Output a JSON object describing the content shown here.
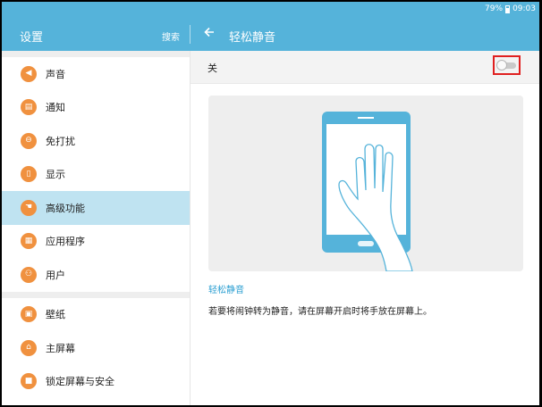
{
  "status_bar": {
    "battery": "79%",
    "time": "09:03"
  },
  "left_header": {
    "title": "设置",
    "search_label": "搜索"
  },
  "right_header": {
    "back_icon": "arrow-left-icon",
    "title": "轻松静音"
  },
  "sidebar": {
    "groups": [
      [
        {
          "label": "声音",
          "icon": "volume-icon",
          "glyph": "◀"
        },
        {
          "label": "通知",
          "icon": "notification-icon",
          "glyph": "▤"
        },
        {
          "label": "免打扰",
          "icon": "do-not-disturb-icon",
          "glyph": "⊖"
        },
        {
          "label": "显示",
          "icon": "display-icon",
          "glyph": "▯"
        },
        {
          "label": "高级功能",
          "icon": "advanced-features-icon",
          "glyph": "☚",
          "selected": true
        },
        {
          "label": "应用程序",
          "icon": "apps-icon",
          "glyph": "▦"
        },
        {
          "label": "用户",
          "icon": "users-icon",
          "glyph": "⚇"
        }
      ],
      [
        {
          "label": "壁纸",
          "icon": "wallpaper-icon",
          "glyph": "▣"
        },
        {
          "label": "主屏幕",
          "icon": "home-icon",
          "glyph": "⌂"
        },
        {
          "label": "锁定屏幕与安全",
          "icon": "lock-icon",
          "glyph": "■"
        }
      ]
    ]
  },
  "content": {
    "switch_state_label": "关",
    "switch_on": false,
    "feature_heading": "轻松静音",
    "feature_description": "若要将闹钟转为静音，请在屏幕开启时将手放在屏幕上。"
  },
  "colors": {
    "accent": "#55b3da",
    "icon_orange": "#f0913f",
    "selected_bg": "#bfe3f1",
    "highlight_box": "#e02020"
  }
}
